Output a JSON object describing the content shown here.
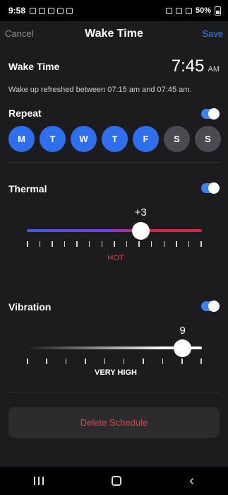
{
  "status_bar": {
    "time": "9:58",
    "battery": "50%"
  },
  "nav": {
    "cancel": "Cancel",
    "title": "Wake Time",
    "save": "Save"
  },
  "wake": {
    "title": "Wake Time",
    "time": "7:45",
    "ampm": "AM",
    "subtext": "Wake up refreshed between 07:15 am and 07:45 am."
  },
  "repeat": {
    "title": "Repeat",
    "enabled": true,
    "days": [
      {
        "label": "M",
        "selected": true
      },
      {
        "label": "T",
        "selected": true
      },
      {
        "label": "W",
        "selected": true
      },
      {
        "label": "T",
        "selected": true
      },
      {
        "label": "F",
        "selected": true
      },
      {
        "label": "S",
        "selected": false
      },
      {
        "label": "S",
        "selected": false
      }
    ]
  },
  "thermal": {
    "title": "Thermal",
    "enabled": true,
    "value": "+3",
    "value_fraction": 0.65,
    "level_label": "HOT",
    "level_color": "#e0424a"
  },
  "vibration": {
    "title": "Vibration",
    "enabled": true,
    "value": "9",
    "value_fraction": 0.89,
    "level_label": "VERY HIGH",
    "level_color": "#ffffff"
  },
  "delete": {
    "label": "Delete Schedule"
  },
  "colors": {
    "accent": "#3b82f6",
    "danger": "#e0424a"
  },
  "system_nav": {
    "icons": [
      "recent-apps-icon",
      "home-icon",
      "back-icon"
    ]
  }
}
